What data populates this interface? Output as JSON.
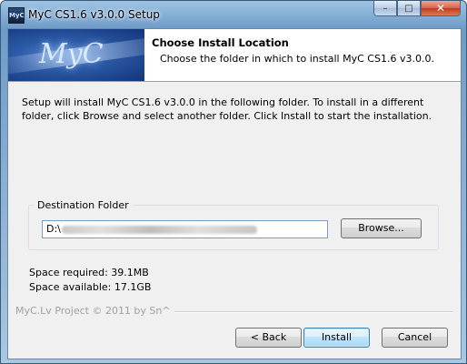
{
  "window": {
    "title": "MyC CS1.6 v3.0.0 Setup",
    "icon_label": "MyC"
  },
  "caption_buttons": {
    "minimize": "–",
    "maximize": "□",
    "close": "✕"
  },
  "header": {
    "logo": "MyC",
    "title": "Choose Install Location",
    "subtitle": "Choose the folder in which to install MyC CS1.6 v3.0.0."
  },
  "intro_text": "Setup will install MyC CS1.6 v3.0.0 in the following folder. To install in a different folder, click Browse and select another folder. Click Install to start the installation.",
  "destination": {
    "group_label": "Destination Folder",
    "path_prefix": "D:\\",
    "browse_label": "Browse..."
  },
  "space": {
    "required": "Space required: 39.1MB",
    "available": "Space available: 17.1GB"
  },
  "branding": "MyC.Lv Project © 2011 by Sn^",
  "buttons": {
    "back": "< Back",
    "install": "Install",
    "cancel": "Cancel"
  }
}
